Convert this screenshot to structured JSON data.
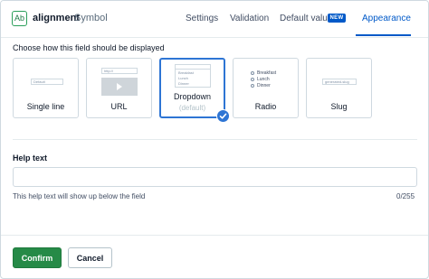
{
  "header": {
    "badge": "Ab",
    "field_name": "alignment",
    "field_type": "Symbol",
    "tabs": [
      {
        "label": "Settings",
        "active": false
      },
      {
        "label": "Validation",
        "active": false
      },
      {
        "label": "Default value",
        "active": false,
        "badge": "NEW"
      },
      {
        "label": "Appearance",
        "active": true
      }
    ]
  },
  "appearance": {
    "instruction": "Choose how this field should be displayed",
    "options": [
      {
        "label": "Single line",
        "preview_placeholder": "Default"
      },
      {
        "label": "URL",
        "preview_placeholder": "http://"
      },
      {
        "label": "Dropdown",
        "sublabel": "(default)",
        "selected": true,
        "preview_items": [
          "Breakfast",
          "Lunch",
          "Dinner"
        ]
      },
      {
        "label": "Radio",
        "preview_items": [
          "Breakfast",
          "Lunch",
          "Dinner"
        ]
      },
      {
        "label": "Slug",
        "preview_placeholder": "generated-slug"
      }
    ]
  },
  "help": {
    "label": "Help text",
    "value": "",
    "note": "This help text will show up below the field",
    "count": "0/255"
  },
  "footer": {
    "confirm_label": "Confirm",
    "cancel_label": "Cancel"
  },
  "colors": {
    "accent": "#0059c8",
    "selected_border": "#2e75d4",
    "confirm_button": "#268a47",
    "badge_green": "#2b9f5a"
  },
  "icons": [
    "play-icon",
    "checkmark-icon"
  ]
}
